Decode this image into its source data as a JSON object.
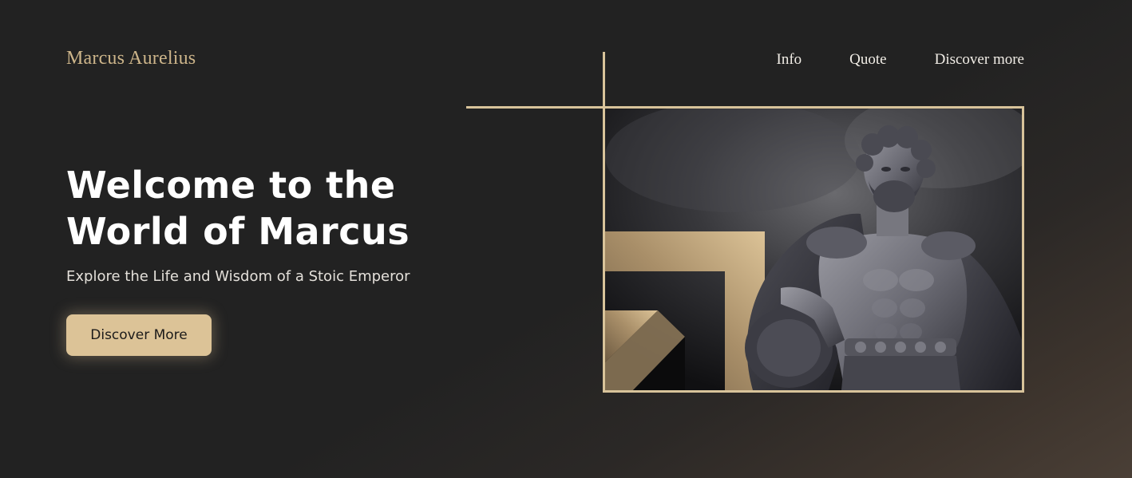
{
  "brand": {
    "name": "Marcus Aurelius",
    "accent_color": "#d8c39a"
  },
  "nav": {
    "items": [
      {
        "label": "Info"
      },
      {
        "label": "Quote"
      },
      {
        "label": "Discover more"
      }
    ]
  },
  "hero": {
    "title_line1": "Welcome to the",
    "title_line2": "World of Marcus",
    "subtitle": "Explore the Life and Wisdom of a Stoic Emperor",
    "cta_label": "Discover More",
    "image": "marcus-aurelius-statue-image"
  }
}
